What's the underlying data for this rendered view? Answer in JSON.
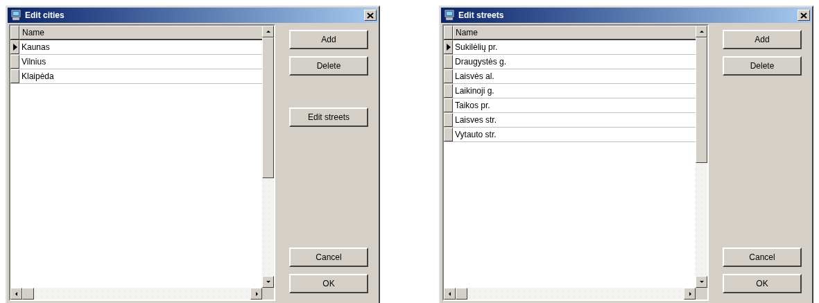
{
  "dialogs": [
    {
      "title": "Edit cities",
      "column": "Name",
      "rows": [
        {
          "name": "Kaunas",
          "selected": true
        },
        {
          "name": "Vilnius",
          "selected": false
        },
        {
          "name": "Klaipėda",
          "selected": false
        }
      ],
      "button_groups": [
        [
          "Add",
          "Delete"
        ],
        [
          "Edit streets"
        ],
        [
          "Cancel",
          "OK"
        ]
      ]
    },
    {
      "title": "Edit streets",
      "column": "Name",
      "rows": [
        {
          "name": "Sukilėlių pr.",
          "selected": true
        },
        {
          "name": "Draugystės g.",
          "selected": false
        },
        {
          "name": "Laisvės al.",
          "selected": false
        },
        {
          "name": "Laikinoji g.",
          "selected": false
        },
        {
          "name": "Taikos pr.",
          "selected": false
        },
        {
          "name": "Laisves str.",
          "selected": false
        },
        {
          "name": "Vytauto str.",
          "selected": false
        }
      ],
      "button_groups": [
        [
          "Add",
          "Delete"
        ],
        [
          "Cancel",
          "OK"
        ]
      ]
    }
  ]
}
